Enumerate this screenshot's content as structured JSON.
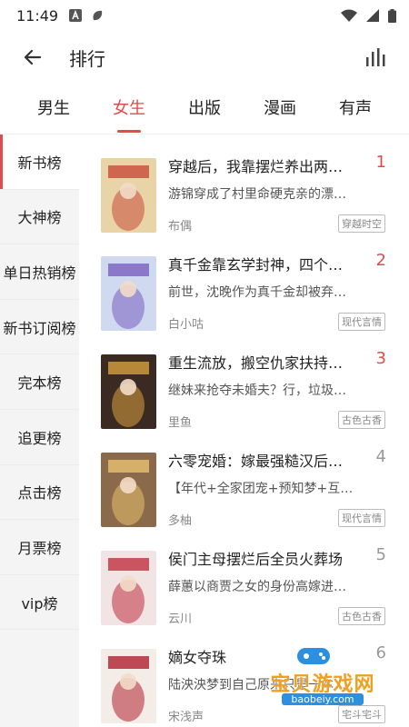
{
  "status_bar": {
    "time": "11:49"
  },
  "header": {
    "title": "排行"
  },
  "tabs": [
    {
      "label": "男生",
      "active": false
    },
    {
      "label": "女生",
      "active": true
    },
    {
      "label": "出版",
      "active": false
    },
    {
      "label": "漫画",
      "active": false
    },
    {
      "label": "有声",
      "active": false
    }
  ],
  "sidebar": {
    "items": [
      {
        "label": "新书榜",
        "active": true
      },
      {
        "label": "大神榜"
      },
      {
        "label": "单日热销榜"
      },
      {
        "label": "新书订阅榜"
      },
      {
        "label": "完本榜"
      },
      {
        "label": "追更榜"
      },
      {
        "label": "点击榜"
      },
      {
        "label": "月票榜"
      },
      {
        "label": "vip榜"
      }
    ]
  },
  "books": [
    {
      "rank": "1",
      "title": "穿越后，我靠摆烂养出两…",
      "desc": "游锦穿成了村里命硬克亲的漂…",
      "author": "布偶",
      "tag": "穿越时空",
      "cover_color": "#e9d4a8",
      "cover_accent": "#c84a3a"
    },
    {
      "rank": "2",
      "title": "真千金靠玄学封神，四个…",
      "desc": "前世，沈晚作为真千金却被弃…",
      "author": "白小咕",
      "tag": "现代言情",
      "cover_color": "#cfd9f0",
      "cover_accent": "#7a5fc0"
    },
    {
      "rank": "3",
      "title": "重生流放，搬空仇家扶持…",
      "desc": "继妹来抢夺未婚夫？行，垃圾…",
      "author": "里鱼",
      "tag": "古色古香",
      "cover_color": "#3a2a22",
      "cover_accent": "#d8a040"
    },
    {
      "rank": "4",
      "title": "六零宠婚：嫁最强糙汉后…",
      "desc": "【年代+全家团宠+预知梦+互…",
      "author": "多柚",
      "tag": "现代言情",
      "cover_color": "#8a6a4a",
      "cover_accent": "#e8c070"
    },
    {
      "rank": "5",
      "title": "侯门主母摆烂后全员火葬场",
      "desc": "薛蕙以商贾之女的身份高嫁进…",
      "author": "云川",
      "tag": "古色古香",
      "cover_color": "#f2e4e4",
      "cover_accent": "#c03040"
    },
    {
      "rank": "6",
      "title": "嫡女夺珠",
      "desc": "陆泱泱梦到自己原来只是一本…",
      "author": "宋浅声",
      "tag": "宅斗宅斗",
      "cover_color": "#f4ece6",
      "cover_accent": "#b02030"
    }
  ],
  "watermark": {
    "text": "宝贝游戏网",
    "url": "baobeiy.com"
  },
  "colors": {
    "accent": "#e14b4b",
    "sidebar_bg": "#f4f4f4"
  },
  "icons": {
    "back": "arrow-left-icon",
    "chart": "bar-chart-icon"
  }
}
